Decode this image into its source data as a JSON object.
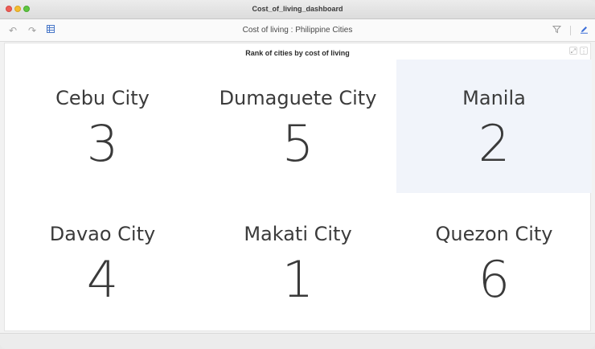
{
  "window": {
    "title": "Cost_of_living_dashboard"
  },
  "toolbar": {
    "title": "Cost of living : Philippine Cities",
    "icons": [
      "undo-icon",
      "redo-icon",
      "sheet-icon",
      "filter-icon",
      "edit-icon"
    ]
  },
  "card": {
    "title": "Rank of cities by cost of living",
    "highlight_color": "#f1f4fa",
    "tiles": [
      {
        "city": "Cebu City",
        "rank": "3"
      },
      {
        "city": "Dumaguete City",
        "rank": "5"
      },
      {
        "city": "Manila",
        "rank": "2"
      },
      {
        "city": "Davao City",
        "rank": "4"
      },
      {
        "city": "Makati City",
        "rank": "1"
      },
      {
        "city": "Quezon City",
        "rank": "6"
      }
    ]
  },
  "colors": {
    "close": "#ee5d56",
    "minimize": "#f4bc2f",
    "maximize": "#5fc63f",
    "accent": "#3c6fd8"
  }
}
